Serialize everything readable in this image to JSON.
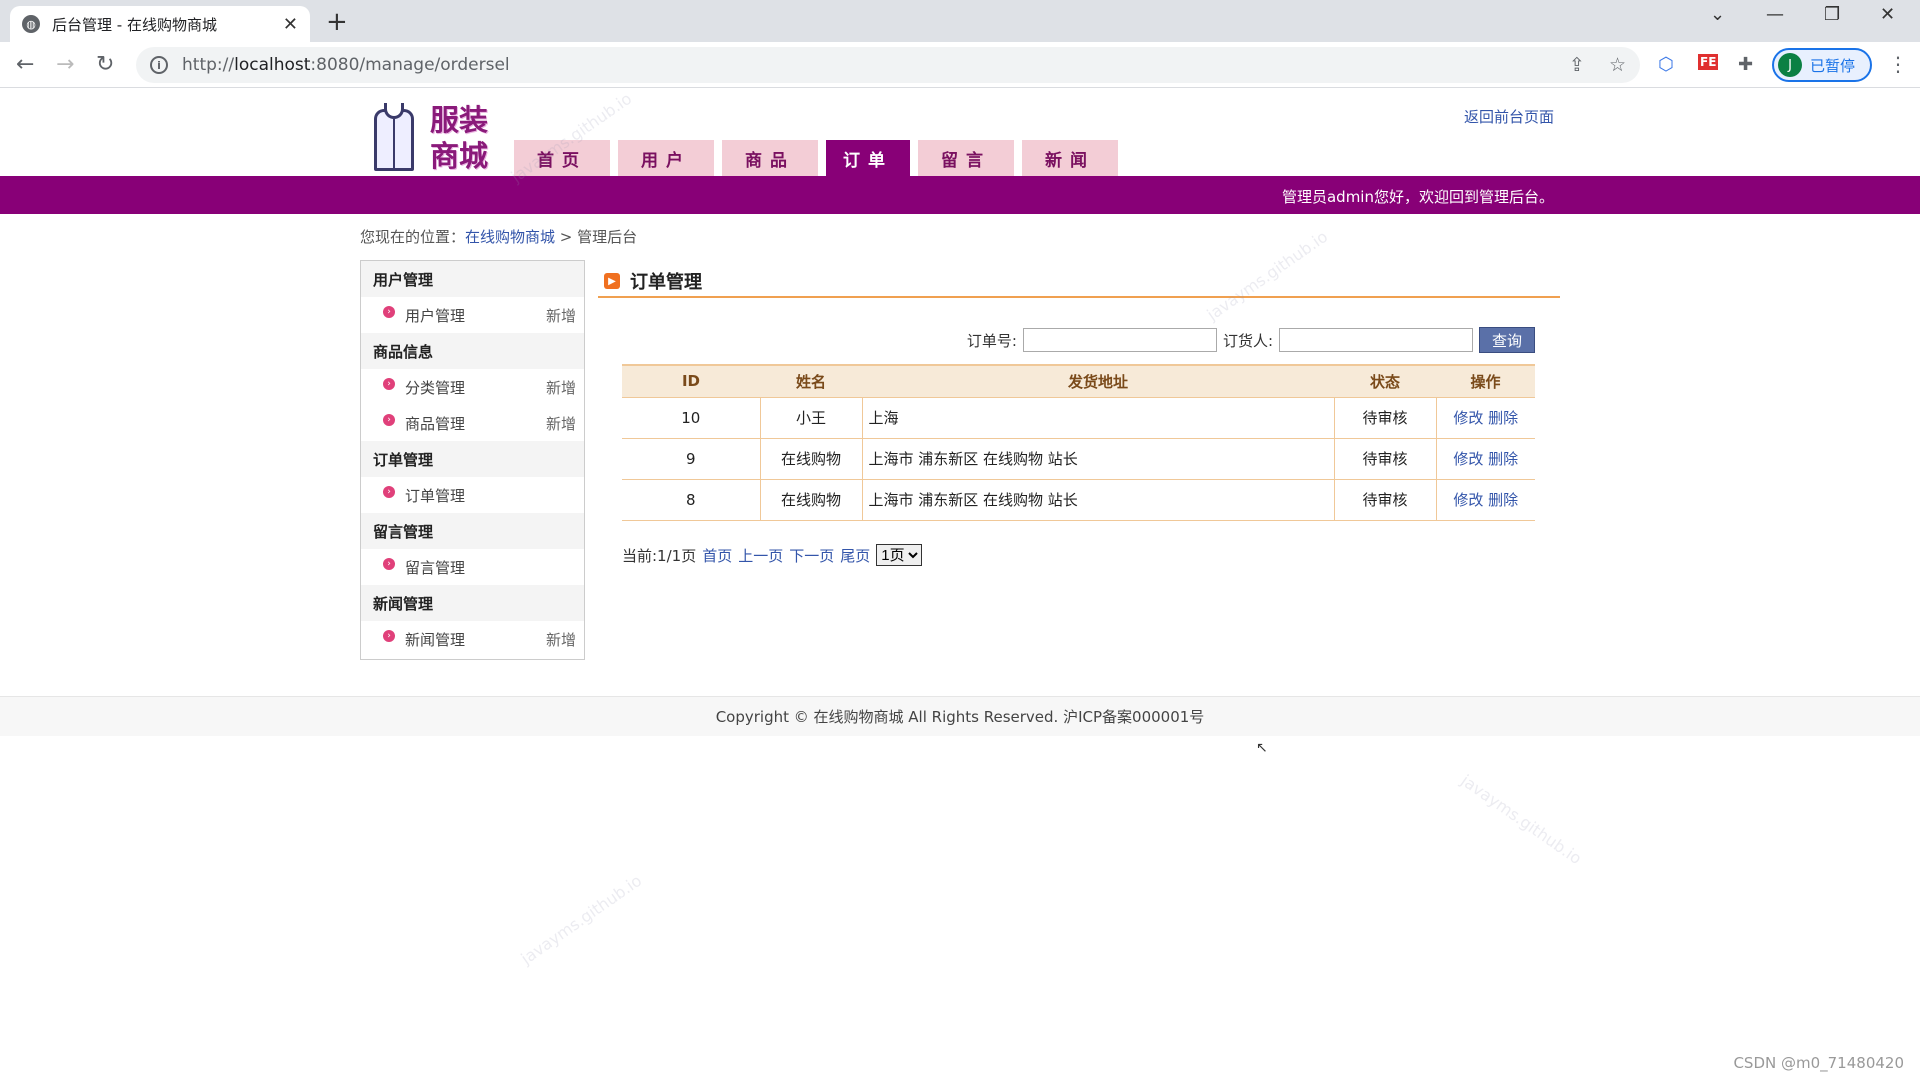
{
  "browser": {
    "tab_title": "后台管理 - 在线购物商城",
    "url_prefix": "http://",
    "url_host": "localhost",
    "url_rest": ":8080/manage/ordersel",
    "profile_initial": "J",
    "profile_label": "已暂停",
    "ext_fe_label": "FE"
  },
  "header": {
    "logo_line1": "服装",
    "logo_line2": "商城",
    "return_link": "返回前台页面",
    "nav": [
      {
        "label": "首页"
      },
      {
        "label": "用户"
      },
      {
        "label": "商品"
      },
      {
        "label": "订单"
      },
      {
        "label": "留言"
      },
      {
        "label": "新闻"
      }
    ],
    "active_nav": "订单",
    "welcome": "管理员admin您好，欢迎回到管理后台。"
  },
  "breadcrumb": {
    "prefix": "您现在的位置：",
    "home": "在线购物商城",
    "sep": " > ",
    "current": "管理后台"
  },
  "sidebar": {
    "groups": [
      {
        "title": "用户管理",
        "items": [
          {
            "label": "用户管理",
            "add": "新增"
          }
        ]
      },
      {
        "title": "商品信息",
        "items": [
          {
            "label": "分类管理",
            "add": "新增"
          },
          {
            "label": "商品管理",
            "add": "新增"
          }
        ]
      },
      {
        "title": "订单管理",
        "items": [
          {
            "label": "订单管理",
            "add": ""
          }
        ]
      },
      {
        "title": "留言管理",
        "items": [
          {
            "label": "留言管理",
            "add": ""
          }
        ]
      },
      {
        "title": "新闻管理",
        "items": [
          {
            "label": "新闻管理",
            "add": "新增"
          }
        ]
      }
    ]
  },
  "main": {
    "title": "订单管理",
    "search": {
      "order_no_label": "订单号:",
      "order_no_value": "",
      "buyer_label": "订货人:",
      "buyer_value": "",
      "button": "查询"
    },
    "table": {
      "headers": [
        "ID",
        "姓名",
        "发货地址",
        "状态",
        "操作"
      ],
      "rows": [
        {
          "id": "10",
          "name": "小王",
          "address": "上海",
          "status": "待审核",
          "edit": "修改",
          "delete": "删除"
        },
        {
          "id": "9",
          "name": "在线购物",
          "address": "上海市 浦东新区 在线购物 站长",
          "status": "待审核",
          "edit": "修改",
          "delete": "删除"
        },
        {
          "id": "8",
          "name": "在线购物",
          "address": "上海市 浦东新区 在线购物 站长",
          "status": "待审核",
          "edit": "修改",
          "delete": "删除"
        }
      ]
    },
    "pager": {
      "current": "当前:1/1页",
      "first": "首页",
      "prev": "上一页",
      "next": "下一页",
      "last": "尾页",
      "select_value": "1页"
    }
  },
  "footer": {
    "text": "Copyright © 在线购物商城 All Rights Reserved. 沪ICP备案000001号"
  },
  "watermark": "javayms.github.io",
  "csdn": "CSDN @m0_71480420"
}
